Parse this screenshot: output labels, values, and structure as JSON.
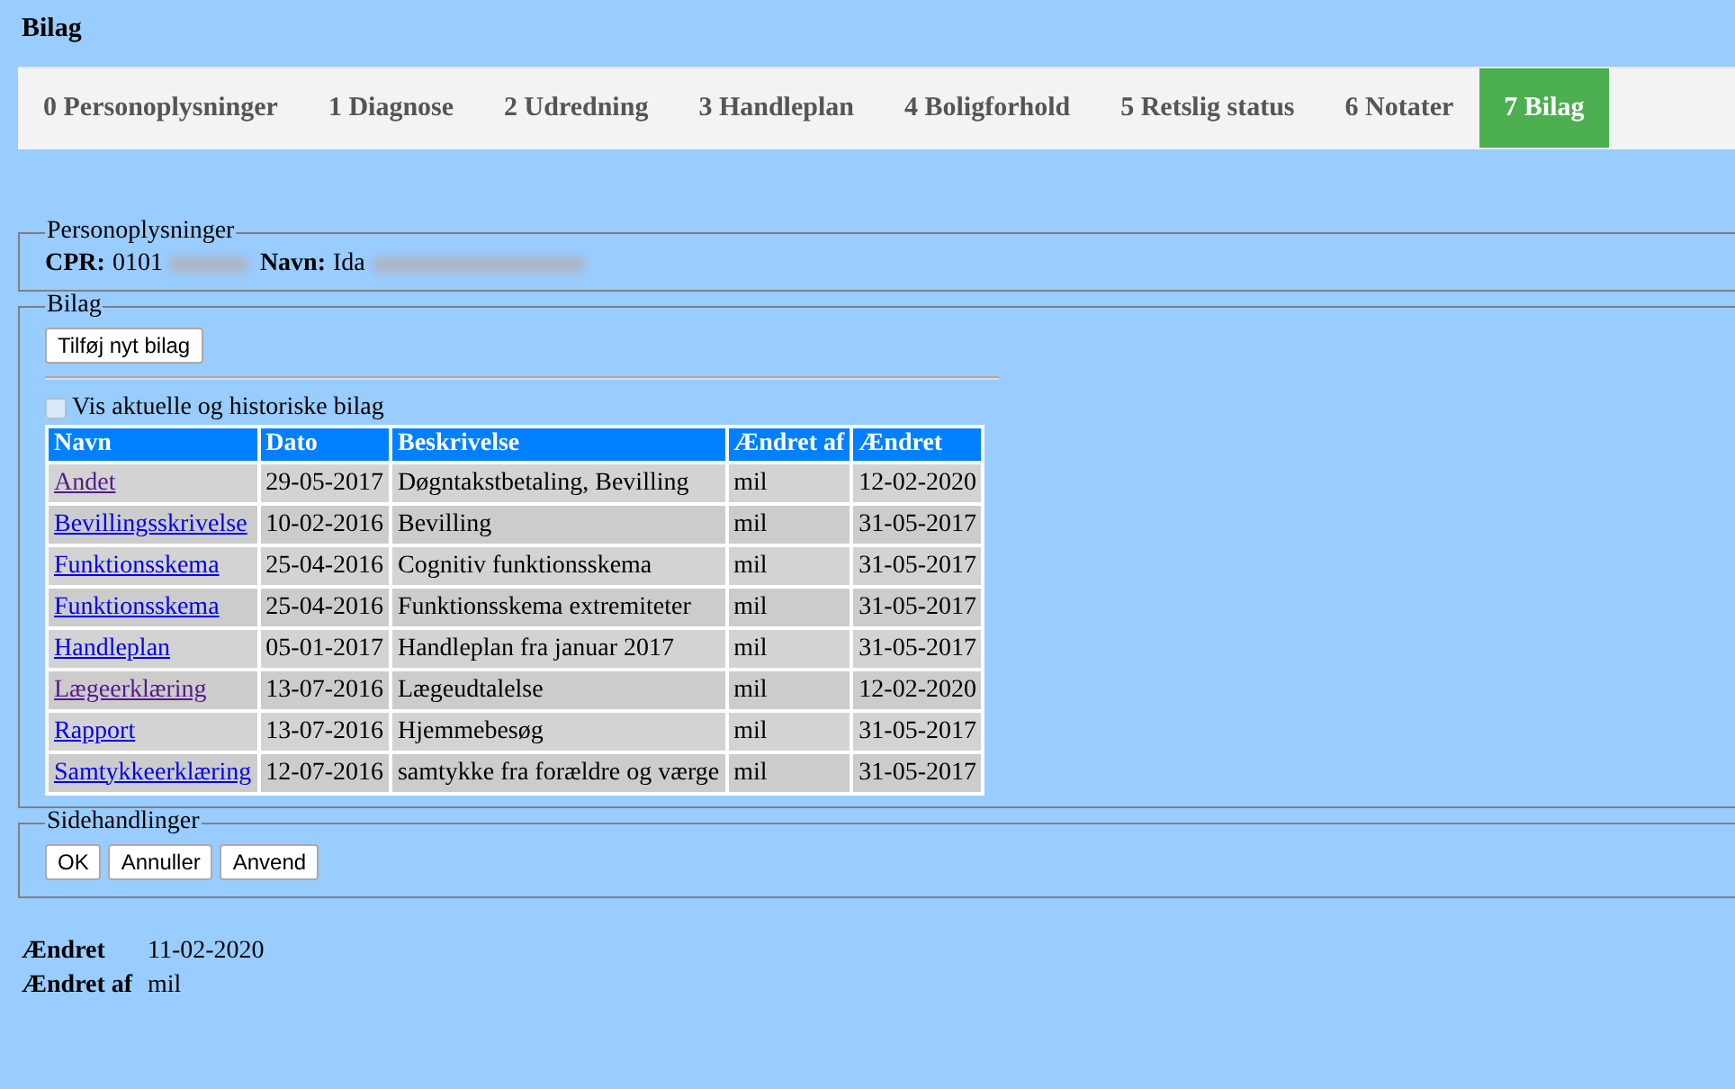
{
  "page_title": "Bilag",
  "tabs": [
    {
      "label": "0 Personoplysninger",
      "selected": false
    },
    {
      "label": "1 Diagnose",
      "selected": false
    },
    {
      "label": "2 Udredning",
      "selected": false
    },
    {
      "label": "3 Handleplan",
      "selected": false
    },
    {
      "label": "4 Boligforhold",
      "selected": false
    },
    {
      "label": "5 Retslig status",
      "selected": false
    },
    {
      "label": "6 Notater",
      "selected": false
    },
    {
      "label": "7 Bilag",
      "selected": true
    }
  ],
  "person": {
    "legend": "Personoplysninger",
    "cpr_label": "CPR:",
    "cpr_value": "0101",
    "name_label": "Navn:",
    "name_value": "Ida"
  },
  "attachments": {
    "legend": "Bilag",
    "add_button": "Tilføj nyt bilag",
    "history_checkbox": {
      "label": "Vis aktuelle og historiske bilag",
      "checked": false
    },
    "table": {
      "columns": [
        "Navn",
        "Dato",
        "Beskrivelse",
        "Ændret af",
        "Ændret"
      ],
      "rows": [
        {
          "name": "Andet",
          "visited": true,
          "date": "29-05-2017",
          "description": "Døgntakstbetaling, Bevilling",
          "changed_by": "mil",
          "changed": "12-02-2020"
        },
        {
          "name": "Bevillingsskrivelse",
          "visited": false,
          "date": "10-02-2016",
          "description": "Bevilling",
          "changed_by": "mil",
          "changed": "31-05-2017"
        },
        {
          "name": "Funktionsskema",
          "visited": false,
          "date": "25-04-2016",
          "description": "Cognitiv funktionsskema",
          "changed_by": "mil",
          "changed": "31-05-2017"
        },
        {
          "name": "Funktionsskema",
          "visited": false,
          "date": "25-04-2016",
          "description": "Funktionsskema extremiteter",
          "changed_by": "mil",
          "changed": "31-05-2017"
        },
        {
          "name": "Handleplan",
          "visited": false,
          "date": "05-01-2017",
          "description": "Handleplan fra januar 2017",
          "changed_by": "mil",
          "changed": "31-05-2017"
        },
        {
          "name": "Lægeerklæring",
          "visited": true,
          "date": "13-07-2016",
          "description": "Lægeudtalelse",
          "changed_by": "mil",
          "changed": "12-02-2020"
        },
        {
          "name": "Rapport",
          "visited": false,
          "date": "13-07-2016",
          "description": "Hjemmebesøg",
          "changed_by": "mil",
          "changed": "31-05-2017"
        },
        {
          "name": "Samtykkeerklæring",
          "visited": false,
          "date": "12-07-2016",
          "description": "samtykke fra forældre og værge",
          "changed_by": "mil",
          "changed": "31-05-2017"
        }
      ]
    }
  },
  "side_actions": {
    "legend": "Sidehandlinger",
    "buttons": [
      "OK",
      "Annuller",
      "Anvend"
    ]
  },
  "footer": [
    {
      "label": "Ændret",
      "value": "11-02-2020"
    },
    {
      "label": "Ændret af",
      "value": "mil"
    }
  ]
}
